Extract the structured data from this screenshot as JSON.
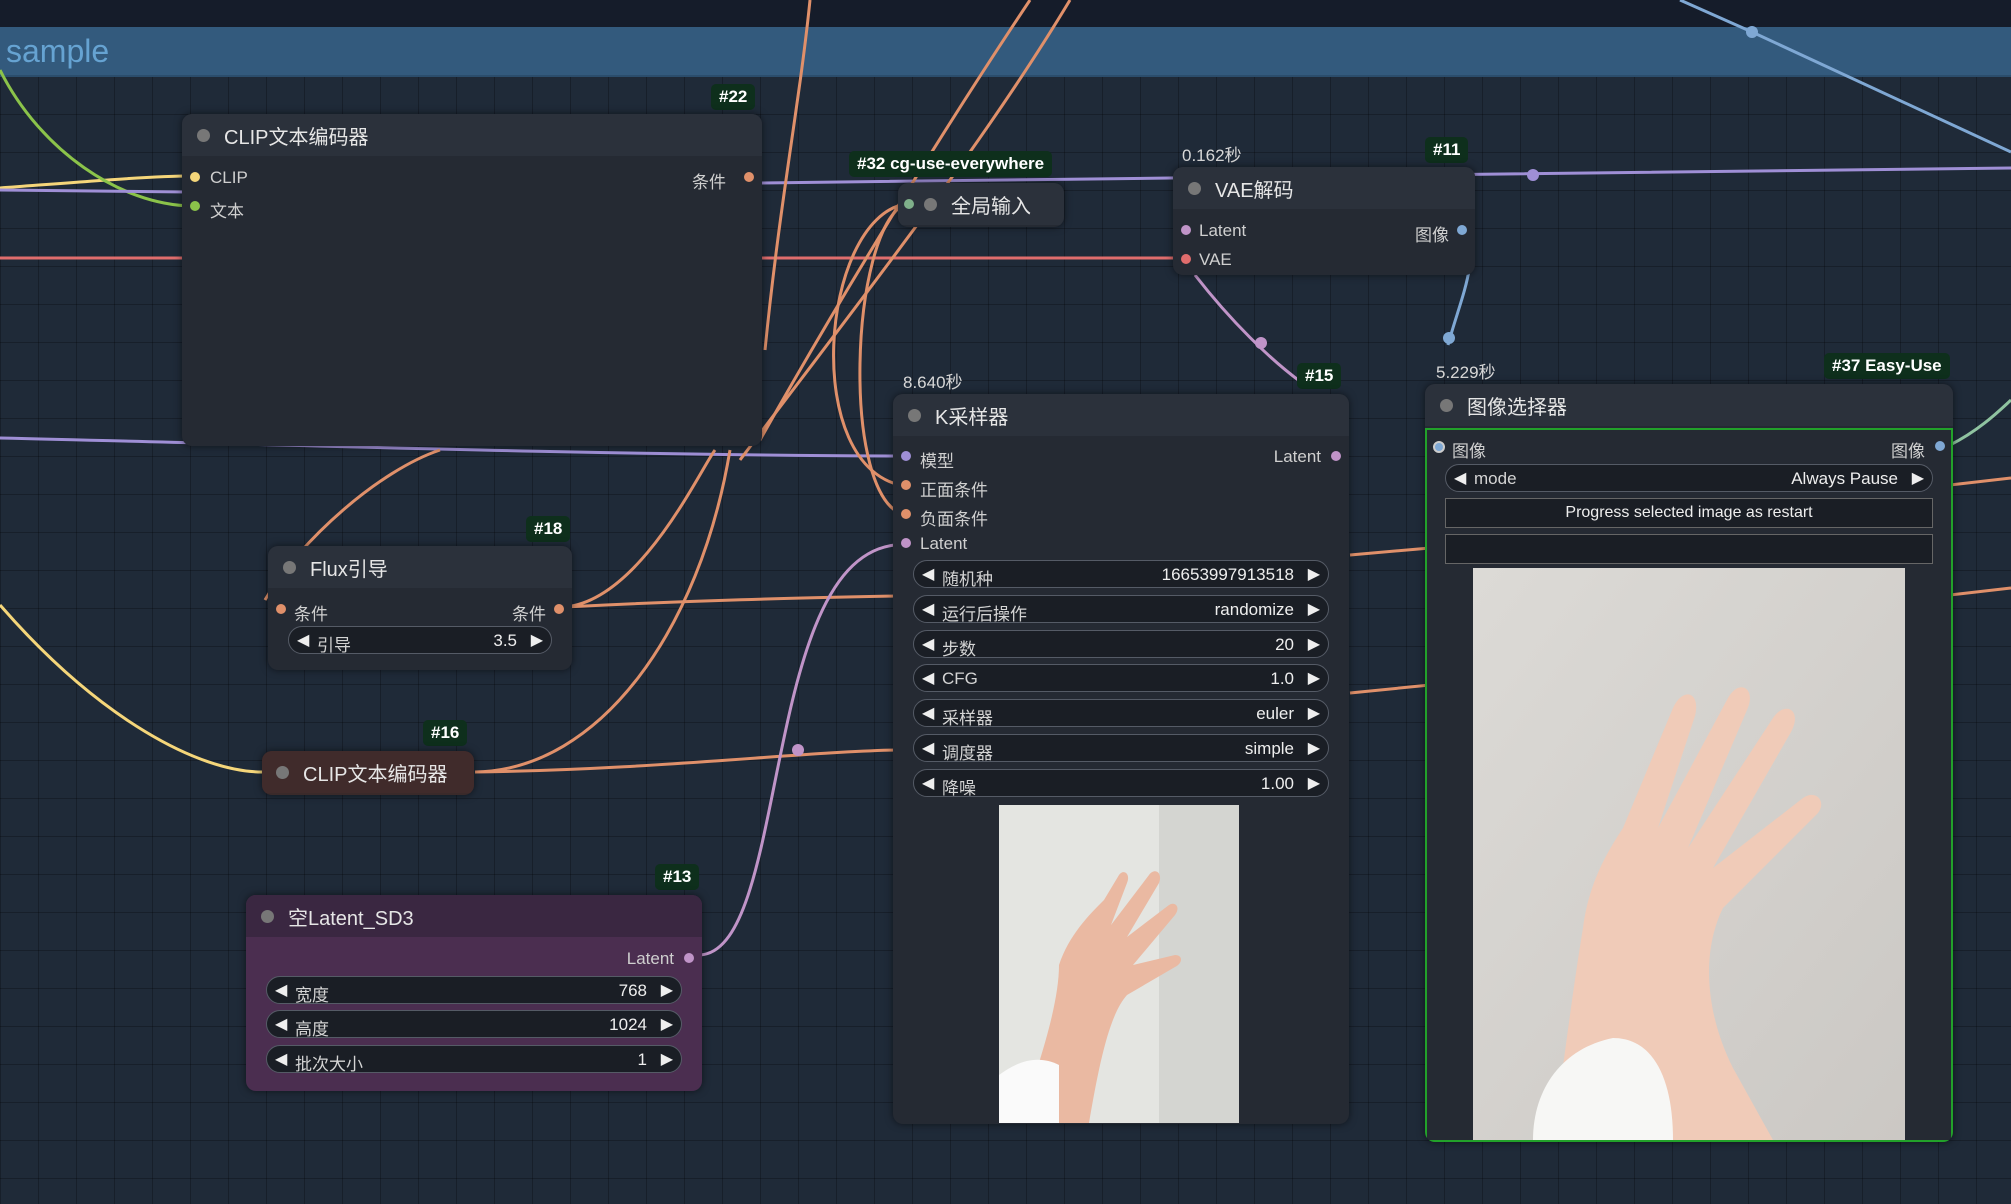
{
  "group": {
    "title": "sample"
  },
  "nodes": {
    "clip_top": {
      "id": "#22",
      "title": "CLIP文本编码器",
      "in1": "CLIP",
      "in2": "文本",
      "out1": "条件"
    },
    "cg": {
      "id": "#32 cg-use-everywhere",
      "title": "全局输入"
    },
    "vae": {
      "id": "#11",
      "time": "0.162秒",
      "title": "VAE解码",
      "in1": "Latent",
      "in2": "VAE",
      "out1": "图像"
    },
    "ksampler": {
      "id": "#15",
      "time": "8.640秒",
      "title": "K采样器",
      "in1": "模型",
      "in2": "正面条件",
      "in3": "负面条件",
      "in4": "Latent",
      "out1": "Latent",
      "widgets": [
        {
          "label": "随机种",
          "value": "16653997913518"
        },
        {
          "label": "运行后操作",
          "value": "randomize"
        },
        {
          "label": "步数",
          "value": "20"
        },
        {
          "label": "CFG",
          "value": "1.0"
        },
        {
          "label": "采样器",
          "value": "euler"
        },
        {
          "label": "调度器",
          "value": "simple"
        },
        {
          "label": "降噪",
          "value": "1.00"
        }
      ]
    },
    "flux": {
      "id": "#18",
      "title": "Flux引导",
      "in1": "条件",
      "out1": "条件",
      "widget_label": "引导",
      "widget_value": "3.5"
    },
    "clip_small": {
      "id": "#16",
      "title": "CLIP文本编码器"
    },
    "latent": {
      "id": "#13",
      "title": "空Latent_SD3",
      "out1": "Latent",
      "widgets": [
        {
          "label": "宽度",
          "value": "768"
        },
        {
          "label": "高度",
          "value": "1024"
        },
        {
          "label": "批次大小",
          "value": "1"
        }
      ]
    },
    "selector": {
      "id": "#37 Easy-Use",
      "time": "5.229秒",
      "title": "图像选择器",
      "in1": "图像",
      "out1": "图像",
      "mode_label": "mode",
      "mode_value": "Always Pause",
      "button": "Progress selected image as restart"
    }
  },
  "colors": {
    "conditioning": "#e0906a",
    "clip": "#f5d67a",
    "text": "#8bc34a",
    "latent": "#c094c8",
    "vae": "#e06d6d",
    "image": "#7fa8d4",
    "model": "#9f8fd6"
  }
}
